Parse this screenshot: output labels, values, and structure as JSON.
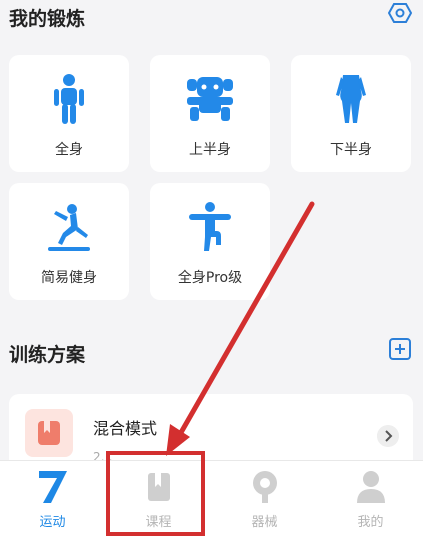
{
  "workout": {
    "title": "我的锻炼",
    "cards": [
      {
        "label": "全身",
        "icon": "full-body-icon"
      },
      {
        "label": "上半身",
        "icon": "upper-body-icon"
      },
      {
        "label": "下半身",
        "icon": "lower-body-icon"
      },
      {
        "label": "简易健身",
        "icon": "easy-fitness-icon"
      },
      {
        "label": "全身Pro级",
        "icon": "full-body-pro-icon"
      }
    ]
  },
  "plans": {
    "title": "训练方案",
    "items": [
      {
        "title": "混合模式",
        "subtitle": "2…"
      }
    ]
  },
  "tabs": [
    {
      "label": "运动",
      "icon": "sport-7-icon",
      "active": true
    },
    {
      "label": "课程",
      "icon": "course-book-icon",
      "active": false
    },
    {
      "label": "器械",
      "icon": "equipment-icon",
      "active": false
    },
    {
      "label": "我的",
      "icon": "profile-icon",
      "active": false
    }
  ],
  "colors": {
    "accent": "#1e88e5",
    "annotation": "#d32f2f",
    "background": "#f4f4f6"
  }
}
